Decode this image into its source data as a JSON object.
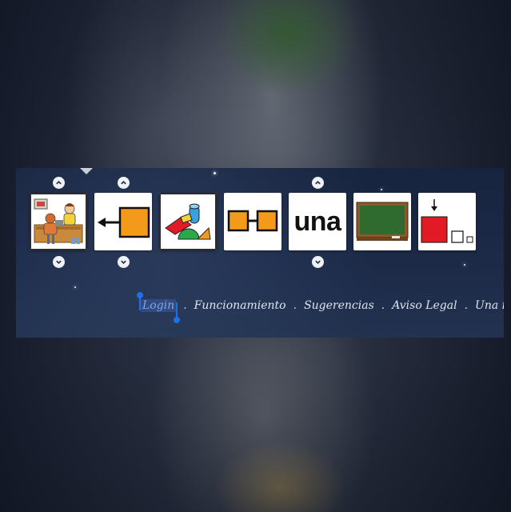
{
  "colors": {
    "banner_bg": "#1c2a48",
    "card_bg": "#ffffff",
    "nav_text": "#dfe5ef",
    "selection_handle": "#1f6fe6",
    "orange": "#f39a1a",
    "red": "#e11b25",
    "chalkboard_green": "#2f6b2f"
  },
  "pictograms": [
    {
      "name": "person-at-desk-icon",
      "word": ""
    },
    {
      "name": "arrow-into-box-icon",
      "word": ""
    },
    {
      "name": "geometric-shapes-icon",
      "word": ""
    },
    {
      "name": "linked-squares-icon",
      "word": ""
    },
    {
      "name": "word-card",
      "word": "una"
    },
    {
      "name": "chalkboard-icon",
      "word": ""
    },
    {
      "name": "red-square-sizes-icon",
      "word": ""
    }
  ],
  "arrows": {
    "up": "chevron-up-icon",
    "down": "chevron-down-icon"
  },
  "nav": {
    "login": "Login",
    "funcionamiento": "Funcionamiento",
    "sugerencias": "Sugerencias",
    "aviso_legal": "Aviso Legal",
    "una_idea": "Una idea",
    "separator": ".",
    "cut_off": "&"
  }
}
